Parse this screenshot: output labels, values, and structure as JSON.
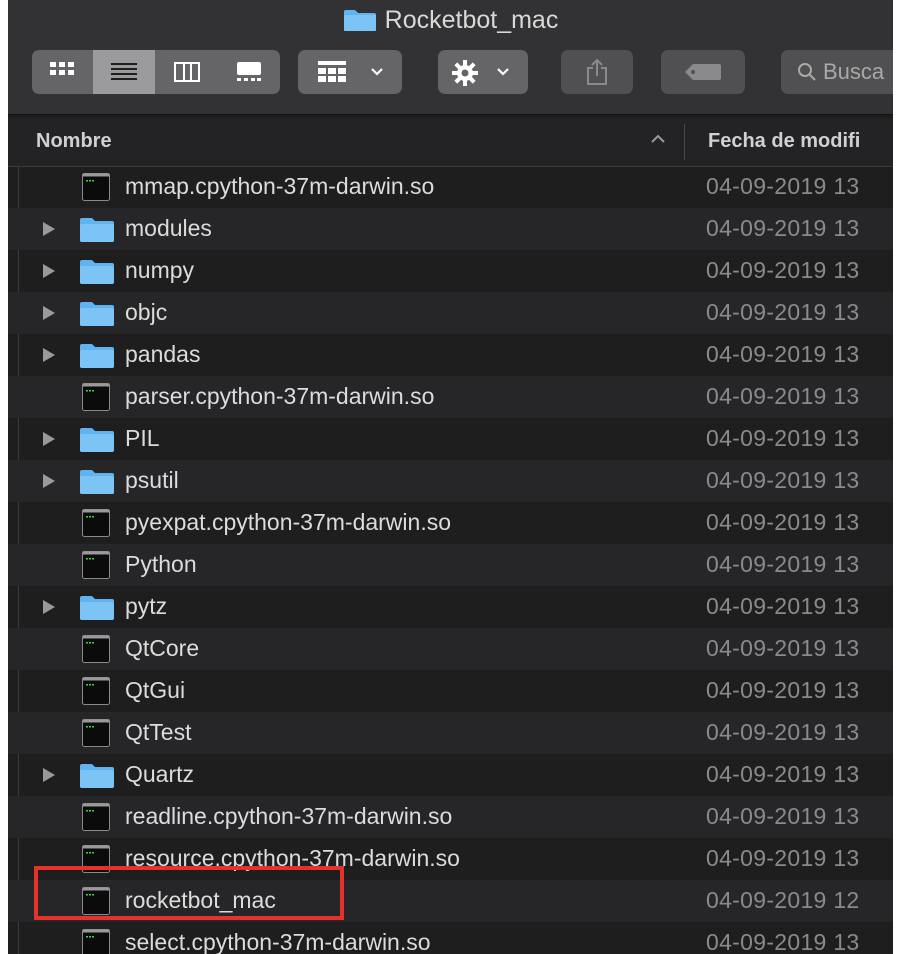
{
  "window": {
    "title": "Rocketbot_mac"
  },
  "toolbar": {
    "search_placeholder": "Busca"
  },
  "columns": {
    "name": "Nombre",
    "date": "Fecha de modifi"
  },
  "rows": [
    {
      "name": "mmap.cpython-37m-darwin.so",
      "date": "04-09-2019 13",
      "type": "exec"
    },
    {
      "name": "modules",
      "date": "04-09-2019 13",
      "type": "folder"
    },
    {
      "name": "numpy",
      "date": "04-09-2019 13",
      "type": "folder"
    },
    {
      "name": "objc",
      "date": "04-09-2019 13",
      "type": "folder"
    },
    {
      "name": "pandas",
      "date": "04-09-2019 13",
      "type": "folder"
    },
    {
      "name": "parser.cpython-37m-darwin.so",
      "date": "04-09-2019 13",
      "type": "exec"
    },
    {
      "name": "PIL",
      "date": "04-09-2019 13",
      "type": "folder"
    },
    {
      "name": "psutil",
      "date": "04-09-2019 13",
      "type": "folder"
    },
    {
      "name": "pyexpat.cpython-37m-darwin.so",
      "date": "04-09-2019 13",
      "type": "exec"
    },
    {
      "name": "Python",
      "date": "04-09-2019 13",
      "type": "exec"
    },
    {
      "name": "pytz",
      "date": "04-09-2019 13",
      "type": "folder"
    },
    {
      "name": "QtCore",
      "date": "04-09-2019 13",
      "type": "exec"
    },
    {
      "name": "QtGui",
      "date": "04-09-2019 13",
      "type": "exec"
    },
    {
      "name": "QtTest",
      "date": "04-09-2019 13",
      "type": "exec"
    },
    {
      "name": "Quartz",
      "date": "04-09-2019 13",
      "type": "folder"
    },
    {
      "name": "readline.cpython-37m-darwin.so",
      "date": "04-09-2019 13",
      "type": "exec"
    },
    {
      "name": "resource.cpython-37m-darwin.so",
      "date": "04-09-2019 13",
      "type": "exec"
    },
    {
      "name": "rocketbot_mac",
      "date": "04-09-2019 12",
      "type": "exec"
    },
    {
      "name": "select.cpython-37m-darwin.so",
      "date": "04-09-2019 13",
      "type": "exec"
    }
  ],
  "colors": {
    "folder": "#5fb4f0",
    "highlight": "#e5322c"
  }
}
